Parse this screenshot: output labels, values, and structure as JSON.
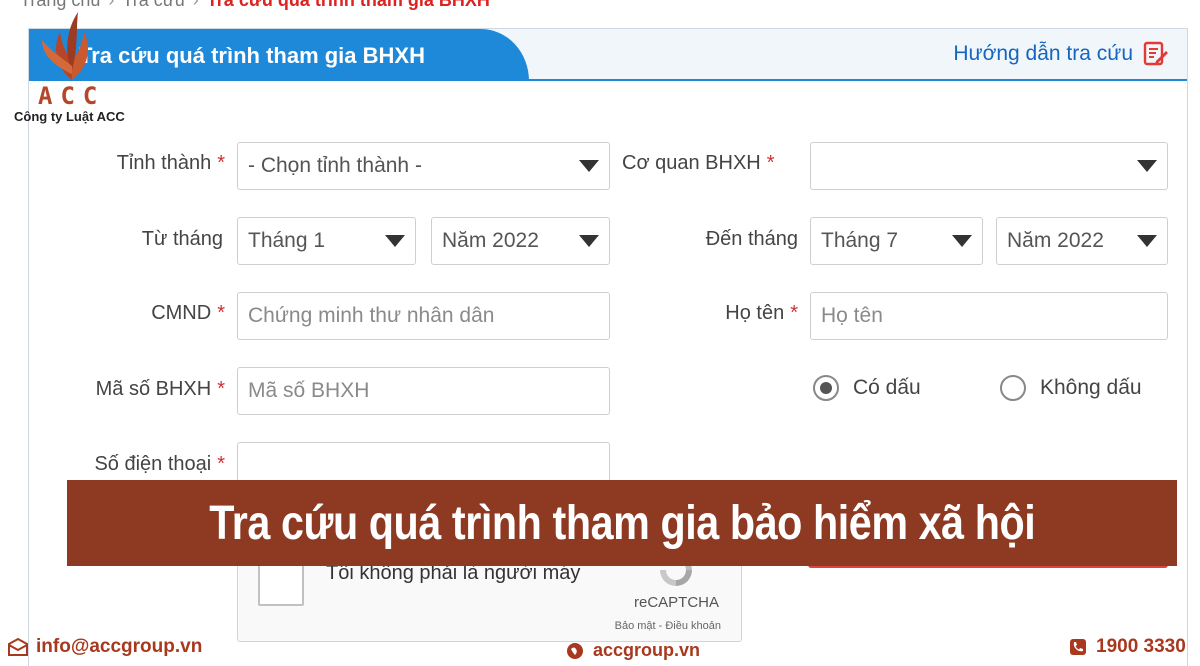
{
  "breadcrumb": {
    "items": [
      "Trang chủ",
      "Tra cứu"
    ],
    "current": "Tra cứu quá trình tham gia BHXH"
  },
  "logo": {
    "text": "ACC",
    "subtitle": "Công ty Luật ACC"
  },
  "panel": {
    "title": "Tra cứu quá trình tham gia BHXH",
    "guide_label": "Hướng dẫn tra cứu",
    "guide_icon": "edit-note-icon"
  },
  "form": {
    "province_label": "Tỉnh thành",
    "province_value": "- Chọn tỉnh thành -",
    "agency_label": "Cơ quan BHXH",
    "agency_value": "",
    "from_label": "Từ tháng",
    "from_month": "Tháng 1",
    "from_year": "Năm 2022",
    "to_label": "Đến tháng",
    "to_month": "Tháng 7",
    "to_year": "Năm 2022",
    "id_label": "CMND",
    "id_placeholder": "Chứng minh thư nhân dân",
    "name_label": "Họ tên",
    "name_placeholder": "Họ tên",
    "insurance_label": "Mã số BHXH",
    "insurance_placeholder": "Mã số BHXH",
    "phone_label": "Số điện thoại",
    "required_mark": "*",
    "accent_option": "Có dấu",
    "no_accent_option": "Không dấu"
  },
  "captcha": {
    "text": "Tôi không phải là người máy",
    "brand": "reCAPTCHA",
    "links": "Bảo mật - Điều khoản"
  },
  "banner": {
    "text": "Tra cứu quá trình tham gia bảo hiểm xã hội"
  },
  "footer": {
    "email": "info@accgroup.vn",
    "website": "accgroup.vn",
    "phone": "1900 3330"
  },
  "colors": {
    "primary_blue": "#1e88d9",
    "required_red": "#d32f2f",
    "banner_brown": "#8e3a22",
    "footer_text": "#a8391f"
  }
}
